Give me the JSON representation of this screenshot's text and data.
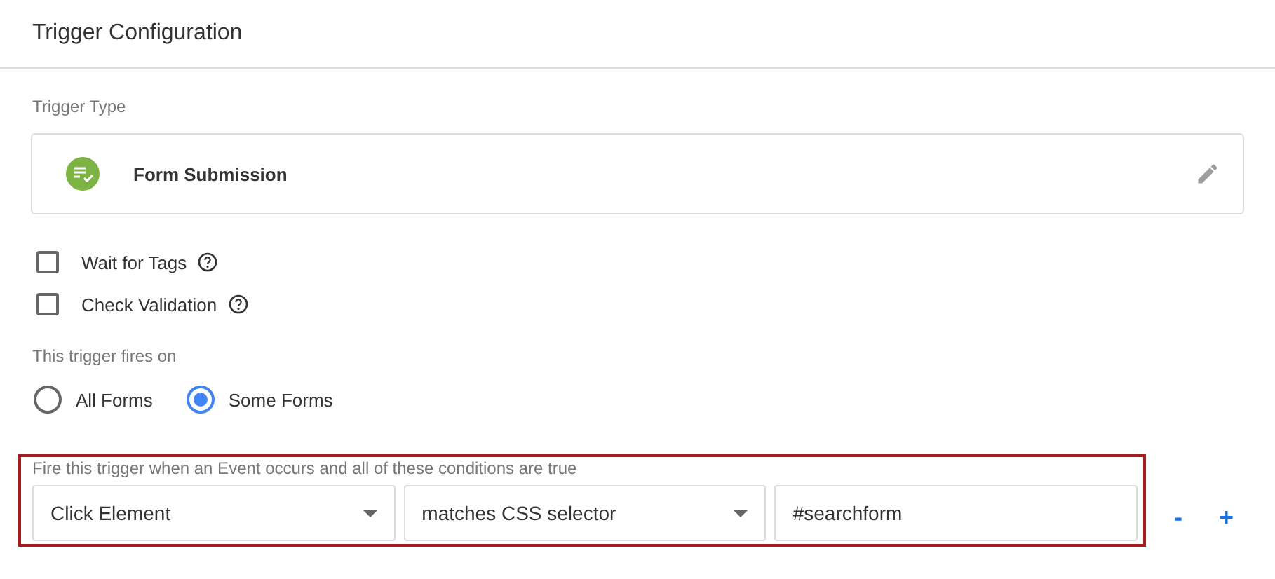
{
  "header": {
    "title": "Trigger Configuration"
  },
  "trigger_type": {
    "label": "Trigger Type",
    "name": "Form Submission"
  },
  "options": [
    {
      "label": "Wait for Tags",
      "checked": false
    },
    {
      "label": "Check Validation",
      "checked": false
    }
  ],
  "fires_on": {
    "label": "This trigger fires on",
    "choices": [
      {
        "label": "All Forms",
        "selected": false
      },
      {
        "label": "Some Forms",
        "selected": true
      }
    ]
  },
  "condition": {
    "label": "Fire this trigger when an Event occurs and all of these conditions are true",
    "variable": "Click Element",
    "operator": "matches CSS selector",
    "value": "#searchform",
    "remove": "-",
    "add": "+"
  }
}
